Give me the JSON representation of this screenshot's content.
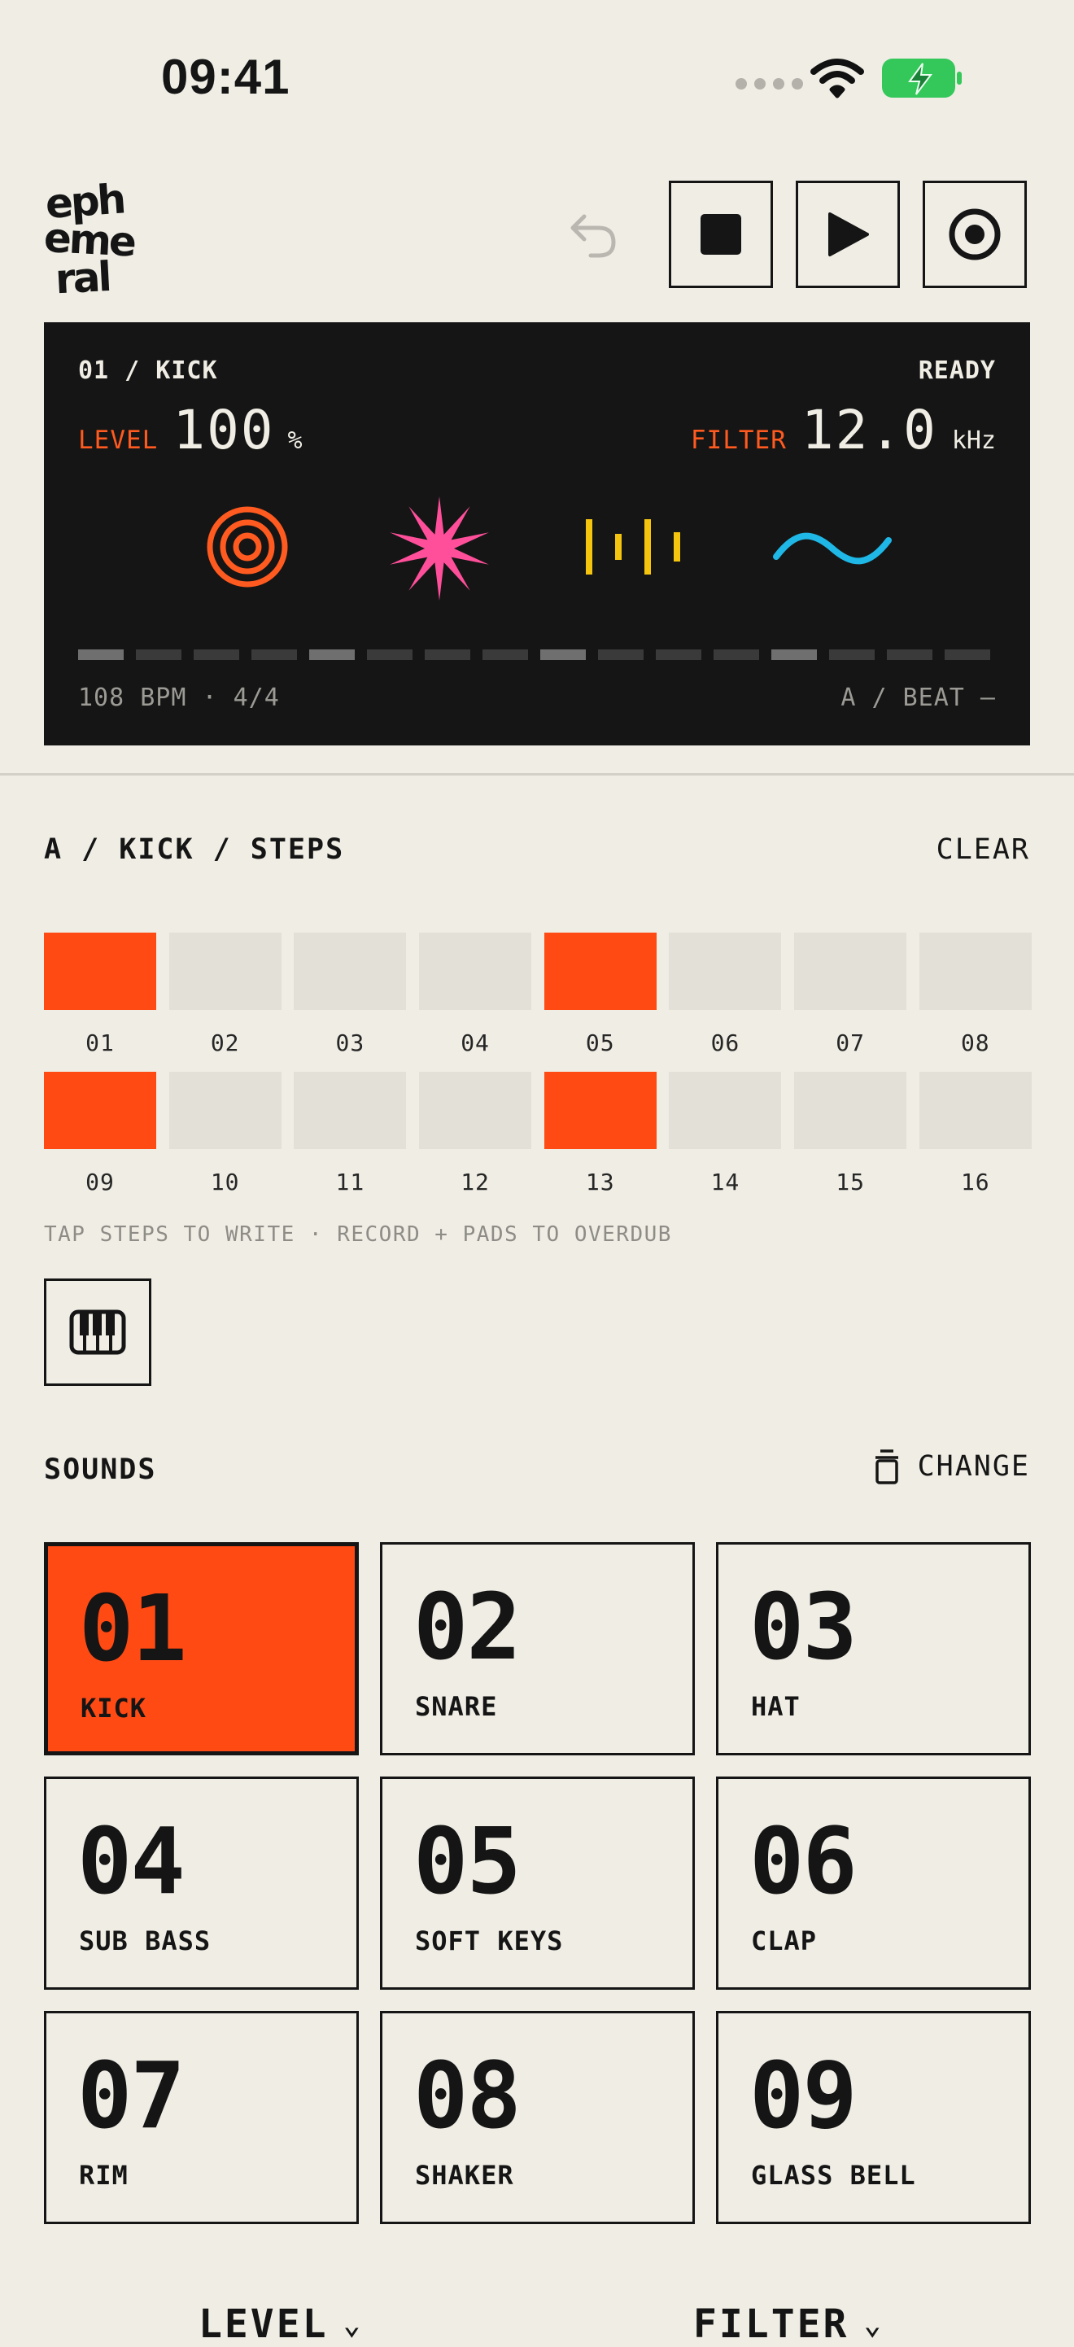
{
  "status_bar": {
    "time": "09:41"
  },
  "header": {
    "logo_text": "ephemeral",
    "icons": [
      "undo-icon",
      "stop-icon",
      "play-icon",
      "record-icon"
    ]
  },
  "display": {
    "track": "01 / KICK",
    "status": "READY",
    "level_label": "LEVEL",
    "level_value": "100",
    "level_unit": "%",
    "filter_label": "FILTER",
    "filter_value": "12.0",
    "filter_unit": "kHz",
    "glyphs": [
      "target-glyph",
      "starburst-glyph",
      "bars-glyph",
      "wave-glyph"
    ],
    "step_segments_active": [
      0,
      4,
      8,
      12
    ],
    "tempo": "108 BPM · 4/4",
    "pattern": "A / BEAT —"
  },
  "steps_section": {
    "title": "A / KICK / STEPS",
    "clear_label": "CLEAR",
    "steps": [
      {
        "num": "01",
        "on": true
      },
      {
        "num": "02",
        "on": false
      },
      {
        "num": "03",
        "on": false
      },
      {
        "num": "04",
        "on": false
      },
      {
        "num": "05",
        "on": true
      },
      {
        "num": "06",
        "on": false
      },
      {
        "num": "07",
        "on": false
      },
      {
        "num": "08",
        "on": false
      },
      {
        "num": "09",
        "on": true
      },
      {
        "num": "10",
        "on": false
      },
      {
        "num": "11",
        "on": false
      },
      {
        "num": "12",
        "on": false
      },
      {
        "num": "13",
        "on": true
      },
      {
        "num": "14",
        "on": false
      },
      {
        "num": "15",
        "on": false
      },
      {
        "num": "16",
        "on": false
      }
    ],
    "hint": "TAP STEPS TO WRITE · RECORD + PADS TO OVERDUB"
  },
  "sounds_section": {
    "title": "SOUNDS",
    "change_label": "CHANGE",
    "pads": [
      {
        "num": "01",
        "name": "KICK",
        "selected": true
      },
      {
        "num": "02",
        "name": "SNARE",
        "selected": false
      },
      {
        "num": "03",
        "name": "HAT",
        "selected": false
      },
      {
        "num": "04",
        "name": "SUB BASS",
        "selected": false
      },
      {
        "num": "05",
        "name": "SOFT KEYS",
        "selected": false
      },
      {
        "num": "06",
        "name": "CLAP",
        "selected": false
      },
      {
        "num": "07",
        "name": "RIM",
        "selected": false
      },
      {
        "num": "08",
        "name": "SHAKER",
        "selected": false
      },
      {
        "num": "09",
        "name": "GLASS BELL",
        "selected": false
      }
    ]
  },
  "bottom_controls": {
    "level_label": "LEVEL",
    "filter_label": "FILTER"
  },
  "colors": {
    "accent": "#ff4a14",
    "background": "#efede4",
    "panel": "#151515",
    "pink": "#ff4f9a",
    "yellow": "#f5c40f",
    "cyan": "#1fb7e6"
  }
}
